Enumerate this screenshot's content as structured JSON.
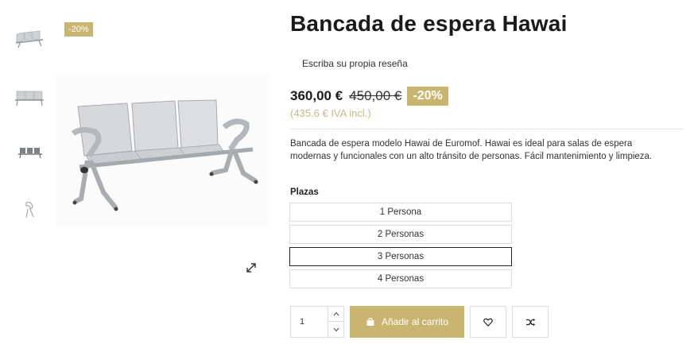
{
  "product": {
    "title": "Bancada de espera Hawai",
    "review_link": "Escriba su propia reseña",
    "discount_badge": "-20%",
    "price_current": "360,00 €",
    "price_old": "450,00 €",
    "price_discount": "-20%",
    "price_tax": "(435.6 € IVA incl.)",
    "description": "Bancada de espera modelo Hawai de Euromof. Hawai es ideal para salas de espera modernas y funcionales con un alto tránsito de personas. Fácil mantenimiento y limpieza."
  },
  "options": {
    "label": "Plazas",
    "items": [
      "1 Persona",
      "2 Personas",
      "3 Personas",
      "4 Personas"
    ],
    "selected": "3 Personas"
  },
  "cart": {
    "quantity": "1",
    "add_label": "Añadir al carrito"
  },
  "icons": {
    "thumbs": [
      "bench-3-seat-angle-icon",
      "bench-front-icon",
      "bench-side-icon",
      "bench-arm-detail-icon"
    ],
    "zoom": "expand-icon",
    "wishlist": "heart-icon",
    "compare": "shuffle-icon",
    "cart": "shopping-bag-icon"
  },
  "colors": {
    "accent": "#c9b56f",
    "tax_text": "#cbb889"
  }
}
